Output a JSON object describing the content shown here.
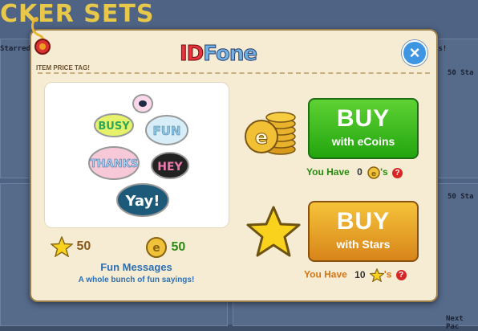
{
  "background": {
    "title": "CKER SETS",
    "starred_label": "Starred",
    "ns_label": "ns!",
    "stars_1": "50 Sta",
    "stars_2": "50 Sta",
    "next_label": "Next Pac"
  },
  "modal": {
    "tag_label": "ITEM PRICE TAG!",
    "brand_id": "ID",
    "brand_fone": "Fone",
    "close_icon": "close-icon",
    "bubbles": [
      "BUSY",
      "FUN",
      "THANKS",
      "HEY",
      "Yay!"
    ],
    "star_price": "50",
    "coin_price": "50",
    "item_title": "Fun Messages",
    "item_desc": "A whole bunch of fun sayings!",
    "buy_coins": {
      "big": "BUY",
      "small": "with eCoins"
    },
    "buy_stars": {
      "big": "BUY",
      "small": "with Stars"
    },
    "have_coins": {
      "label": "You Have",
      "value": "0",
      "suffix": "'s"
    },
    "have_stars": {
      "label": "You Have",
      "value": "10",
      "suffix": "'s"
    },
    "help_symbol": "?"
  },
  "colors": {
    "green": "#23a50f",
    "orange": "#d8851a",
    "blue_text": "#2d6fb3",
    "brown_text": "#6e5330",
    "have_coins_color": "#2b8a12",
    "have_stars_color": "#d6740f"
  }
}
